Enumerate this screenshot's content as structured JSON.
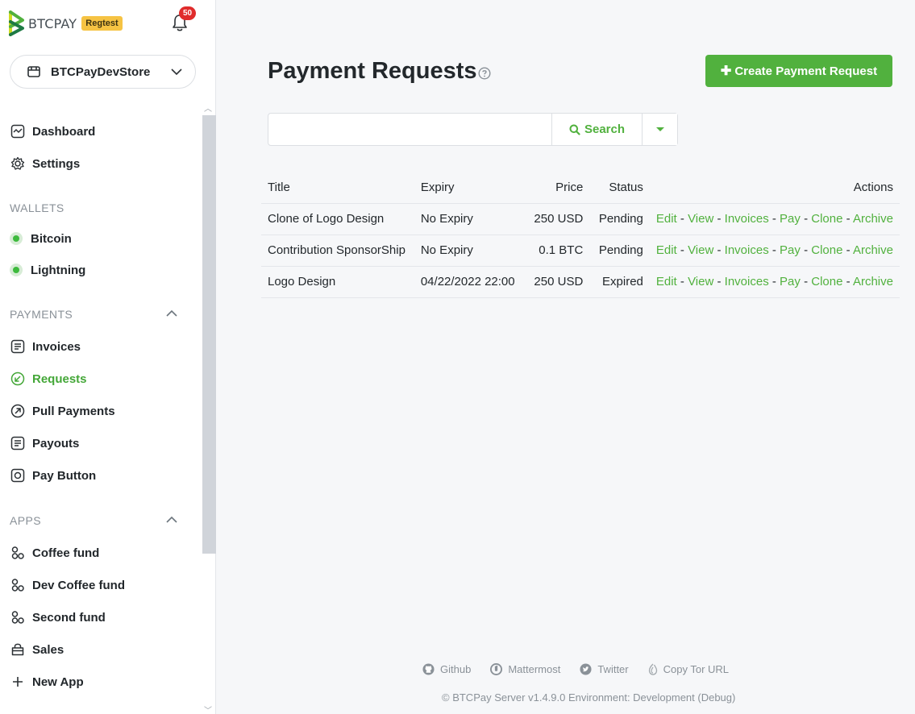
{
  "brand": {
    "name": "BTCPAY",
    "env_badge": "Regtest"
  },
  "notifications": {
    "count": "50"
  },
  "store_selector": {
    "label": "BTCPayDevStore"
  },
  "nav": {
    "dashboard": "Dashboard",
    "settings": "Settings",
    "wallets_heading": "WALLETS",
    "bitcoin": "Bitcoin",
    "lightning": "Lightning",
    "payments_heading": "PAYMENTS",
    "invoices": "Invoices",
    "requests": "Requests",
    "pull_payments": "Pull Payments",
    "payouts": "Payouts",
    "pay_button": "Pay Button",
    "apps_heading": "APPS",
    "coffee_fund": "Coffee fund",
    "dev_coffee_fund": "Dev Coffee fund",
    "second_fund": "Second fund",
    "sales": "Sales",
    "new_app": "New App"
  },
  "page": {
    "title": "Payment Requests",
    "create_button": "Create Payment Request"
  },
  "search": {
    "placeholder": "",
    "button": "Search"
  },
  "table": {
    "headers": {
      "title": "Title",
      "expiry": "Expiry",
      "price": "Price",
      "status": "Status",
      "actions": "Actions"
    },
    "actions": [
      "Edit",
      "View",
      "Invoices",
      "Pay",
      "Clone",
      "Archive"
    ],
    "rows": [
      {
        "title": "Clone of Logo Design",
        "expiry": "No Expiry",
        "price": "250 USD",
        "status": "Pending"
      },
      {
        "title": "Contribution SponsorShip",
        "expiry": "No Expiry",
        "price": "0.1 BTC",
        "status": "Pending"
      },
      {
        "title": "Logo Design",
        "expiry": "04/22/2022 22:00",
        "price": "250 USD",
        "status": "Expired"
      }
    ]
  },
  "footer": {
    "github": "Github",
    "mattermost": "Mattermost",
    "twitter": "Twitter",
    "tor": "Copy Tor URL",
    "copyright": "© BTCPay Server v1.4.9.0 Environment: Development (Debug)"
  },
  "colors": {
    "accent": "#51b13e",
    "badge": "#f6c343",
    "notification": "#e02c2c"
  }
}
